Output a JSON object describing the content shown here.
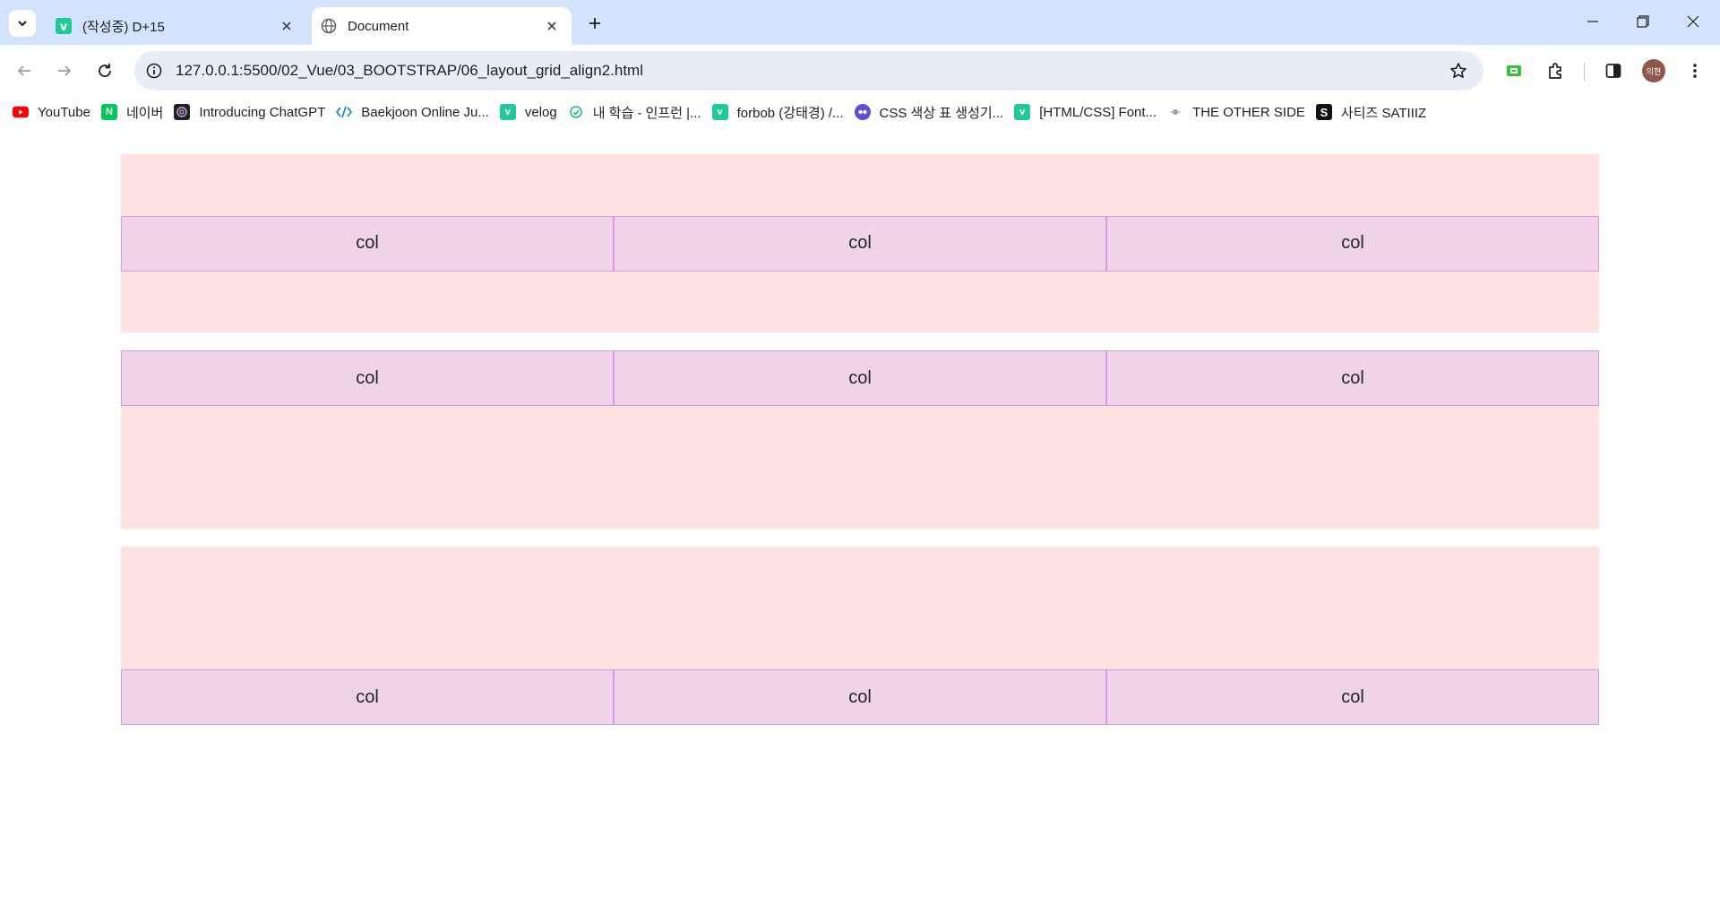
{
  "browser": {
    "tabs": [
      {
        "title": "(작성중) D+15",
        "favicon": "velog-icon",
        "active": false
      },
      {
        "title": "Document",
        "favicon": "globe-icon",
        "active": true
      }
    ],
    "url": "127.0.0.1:5500/02_Vue/03_BOOTSTRAP/06_layout_grid_align2.html",
    "avatar_text": "의현",
    "bookmarks": [
      {
        "label": "YouTube",
        "icon": "youtube-icon",
        "color": "#ff0000"
      },
      {
        "label": "네이버",
        "icon": "naver-icon",
        "color": "#03c75a"
      },
      {
        "label": "Introducing ChatGPT",
        "icon": "chatgpt-icon",
        "color": "#202123"
      },
      {
        "label": "Baekjoon Online Ju...",
        "icon": "baekjoon-icon",
        "color": "#0076c0"
      },
      {
        "label": "velog",
        "icon": "velog-icon",
        "color": "#20c997"
      },
      {
        "label": "내 학습 - 인프런 |...",
        "icon": "inflearn-icon",
        "color": "#1dc078"
      },
      {
        "label": "forbob (강태경) /...",
        "icon": "velog-icon",
        "color": "#20c997"
      },
      {
        "label": "CSS 색상 표 생성기...",
        "icon": "css-palette-icon",
        "color": "#5b4fd8"
      },
      {
        "label": "[HTML/CSS] Font...",
        "icon": "velog-icon",
        "color": "#20c997"
      },
      {
        "label": "THE OTHER SIDE",
        "icon": "otherside-icon",
        "color": "#9e9e9e"
      },
      {
        "label": "사티즈 SATIIIZ",
        "icon": "satiiiz-icon",
        "color": "#111111"
      }
    ]
  },
  "page": {
    "containers": [
      {
        "align": "center",
        "cols": [
          "col",
          "col",
          "col"
        ]
      },
      {
        "align": "start",
        "cols": [
          "col",
          "col",
          "col"
        ]
      },
      {
        "align": "end",
        "cols": [
          "col",
          "col",
          "col"
        ]
      }
    ]
  }
}
